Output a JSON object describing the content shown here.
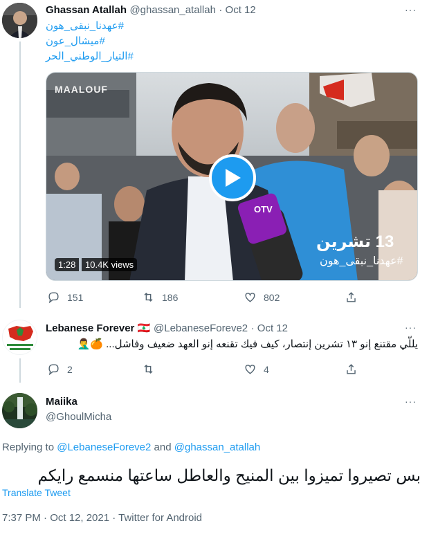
{
  "tweet1": {
    "name": "Ghassan Atallah",
    "handle": "@ghassan_atallah",
    "date": "· Oct 12",
    "hashtags": [
      "#عهدنا_نبقى_هون",
      "#ميشال_عون",
      "#التيار_الوطني_الحر"
    ],
    "video": {
      "duration": "1:28",
      "views": "10.4K views",
      "overlay_title": "13 تشرين",
      "overlay_hashtag": "#عهدنا_نبقى_هون",
      "shop_sign": "MAALOUF",
      "mic_logo": "OTV"
    },
    "actions": {
      "replies": "151",
      "retweets": "186",
      "likes": "802"
    }
  },
  "tweet2": {
    "name": "Lebanese Forever",
    "flag": "🇱🇧",
    "handle": "@LebaneseForeve2",
    "date": "· Oct 12",
    "text": "يللّي مقتنع إنو ١٣ تشرين إنتصار، كيف فيك تقنعه إنو العهد ضعيف وفاشل... 🍊🤦‍♂️",
    "actions": {
      "replies": "2",
      "retweets": "",
      "likes": "4"
    }
  },
  "main": {
    "name": "Maiika",
    "handle": "@GhoulMicha",
    "replying_prefix": "Replying to",
    "replying_user1": "@LebaneseForeve2",
    "replying_and": "and",
    "replying_user2": "@ghassan_atallah",
    "text": "بس تصيروا تميزوا بين المنيح والعاطل ساعتها منسمع رايكم",
    "translate": "Translate Tweet",
    "timestamp": "7:37 PM · Oct 12, 2021 · Twitter for Android"
  },
  "more_label": "···",
  "colors": {
    "accent": "#1d9bf0",
    "secondary_text": "#536471",
    "line": "#cfd9de",
    "play": "#1d9bf0"
  }
}
